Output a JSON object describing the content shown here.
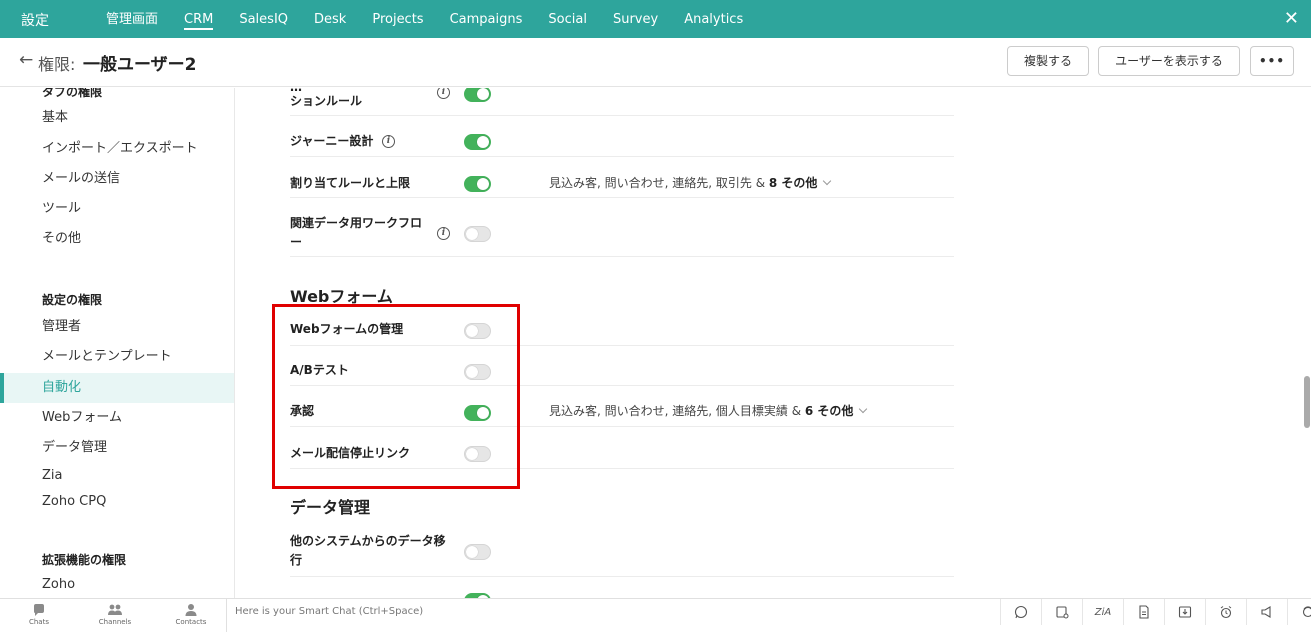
{
  "topbar": {
    "title": "設定",
    "nav": [
      "管理画面",
      "CRM",
      "SalesIQ",
      "Desk",
      "Projects",
      "Campaigns",
      "Social",
      "Survey",
      "Analytics"
    ],
    "active": "CRM",
    "close": "✕"
  },
  "header": {
    "back": "←",
    "crumb": "権限:",
    "title": "一般ユーザー2",
    "copy_button": "複製する",
    "show_users_button": "ユーザーを表示する",
    "more_button": "•••"
  },
  "sidebar": {
    "tab_section_title": "タブの権限",
    "tab_items": [
      "基本",
      "インポート／エクスポート",
      "メールの送信",
      "ツール",
      "その他"
    ],
    "settings_section_title": "設定の権限",
    "settings_items": [
      "管理者",
      "メールとテンプレート",
      "自動化",
      "Webフォーム",
      "データ管理",
      "Zia",
      "Zoho CPQ"
    ],
    "active_item": "自動化",
    "ext_section_title": "拡張機能の権限",
    "ext_items": [
      "Zoho"
    ]
  },
  "main": {
    "automation_rows": [
      {
        "label": "ションルール",
        "label_partial_top": "…",
        "enabled": true,
        "info": true
      },
      {
        "label": "ジャーニー設計",
        "enabled": true,
        "info": true
      },
      {
        "label": "割り当てルールと上限",
        "enabled": true,
        "modules": "見込み客, 問い合わせ, 連絡先, 取引先 &",
        "more": "8 その他"
      },
      {
        "label_line1": "関連データ用ワークフロ",
        "label_line2": "ー",
        "enabled": false,
        "info": true
      }
    ],
    "webform_section": "Webフォーム",
    "webform_rows": [
      {
        "label": "Webフォームの管理",
        "enabled": false
      },
      {
        "label": "A/Bテスト",
        "enabled": false
      },
      {
        "label": "承認",
        "enabled": true,
        "modules": "見込み客, 問い合わせ, 連絡先, 個人目標実績 &",
        "more": "6 その他"
      },
      {
        "label": "メール配信停止リンク",
        "enabled": false
      }
    ],
    "data_section": "データ管理",
    "data_rows": [
      {
        "label_line1": "他のシステムからのデータ移",
        "label_line2": "行",
        "enabled": false
      }
    ]
  },
  "footer": {
    "chats": "Chats",
    "channels": "Channels",
    "contacts": "Contacts",
    "smart_chat_placeholder": "Here is your Smart Chat (Ctrl+Space)",
    "right_icons": [
      "whatsapp-icon",
      "call-settings-icon",
      "zia-icon",
      "document-icon",
      "download-icon",
      "alarm-icon",
      "announcement-icon",
      "support-icon"
    ]
  },
  "colors": {
    "brand": "#2ea59c",
    "toggle_on": "#43b25b",
    "highlight": "#e00000"
  }
}
